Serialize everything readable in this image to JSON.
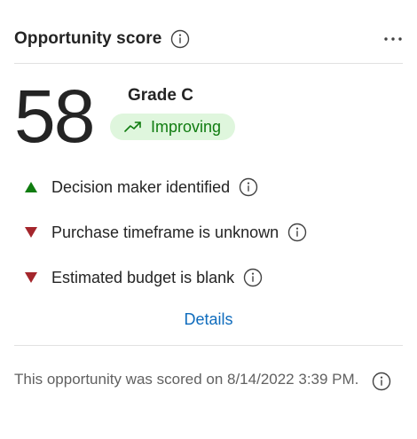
{
  "card": {
    "title": "Opportunity score",
    "more_label": "..."
  },
  "score": {
    "value": "58",
    "grade": "Grade C",
    "trend": "Improving"
  },
  "insights": [
    {
      "text": "Decision maker identified",
      "direction": "up",
      "color": "#107c10"
    },
    {
      "text": "Purchase timeframe is unknown",
      "direction": "down",
      "color": "#a4262c"
    },
    {
      "text": "Estimated budget is blank",
      "direction": "down",
      "color": "#a4262c"
    }
  ],
  "details_link": "Details",
  "footer": {
    "text": "This opportunity was scored on 8/14/2022 3:39 PM."
  },
  "icons": {
    "info": "info-circle-icon",
    "more": "more-horizontal-icon",
    "trend": "trending-up-icon",
    "up": "triangle-up-icon",
    "down": "triangle-down-icon"
  },
  "colors": {
    "positive": "#107c10",
    "negative": "#a4262c",
    "badge_bg": "#dff6dd",
    "link": "#0f6cbd"
  }
}
